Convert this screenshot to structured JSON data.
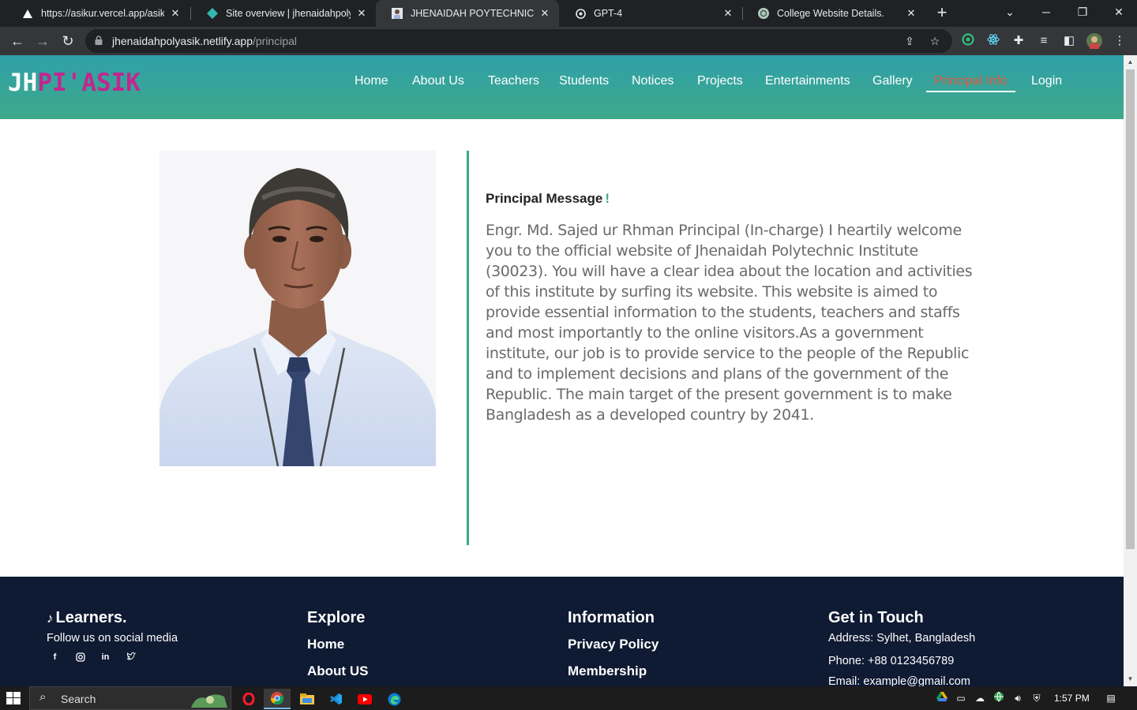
{
  "browser": {
    "tabs": [
      {
        "title": "https://asikur.vercel.app/asikur/",
        "favicon": "vercel-icon"
      },
      {
        "title": "Site overview | jhenaidahpolyasik",
        "favicon": "netlify-icon"
      },
      {
        "title": "JHENAIDAH POYTECHNIC INSTITUTE",
        "favicon": "portrait-favicon",
        "active": true
      },
      {
        "title": "GPT-4",
        "favicon": "openai-icon"
      },
      {
        "title": "College Website Details.",
        "favicon": "chatgpt-icon"
      }
    ],
    "url_host": "jhenaidahpolyasik.netlify.app",
    "url_path": "/principal"
  },
  "site": {
    "logo_part1": "JH",
    "logo_part2": "PI'ASIK",
    "nav": [
      {
        "label": "Home"
      },
      {
        "label": "About Us"
      },
      {
        "label": "Teachers"
      },
      {
        "label": "Students"
      },
      {
        "label": "Notices"
      },
      {
        "label": "Projects"
      },
      {
        "label": "Entertainments"
      },
      {
        "label": "Gallery"
      },
      {
        "label": "Principal Info",
        "active": true
      },
      {
        "label": "Login"
      }
    ],
    "accent_color": "#3aa986",
    "active_nav_color": "#e8553c"
  },
  "principal": {
    "title": "Principal Message",
    "title_mark": "!",
    "message": "Engr. Md. Sajed ur Rhman Principal (In-charge) I heartily welcome you to the official website of Jhenaidah Polytechnic Institute (30023). You will have a clear idea about the location and activities of this institute by surfing its website. This website is aimed to provide essential information to the students, teachers and staffs and most importantly to the online visitors.As a government institute, our job is to provide service to the people of the Republic and to implement decisions and plans of the government of the Republic. The main target of the present government is to make Bangladesh as a developed country by 2041."
  },
  "footer": {
    "brand": "Learners.",
    "follow": "Follow us on social media",
    "social": [
      "facebook-icon",
      "instagram-icon",
      "linkedin-icon",
      "twitter-icon"
    ],
    "explore_title": "Explore",
    "explore_links": [
      "Home",
      "About US"
    ],
    "info_title": "Information",
    "info_links": [
      "Privacy Policy",
      "Membership"
    ],
    "contact_title": "Get in Touch",
    "address": "Address: Sylhet, Bangladesh",
    "phone": "Phone: +88 0123456789",
    "email": "Email: example@gmail.com"
  },
  "taskbar": {
    "search_placeholder": "Search",
    "time": "1:57 PM"
  }
}
